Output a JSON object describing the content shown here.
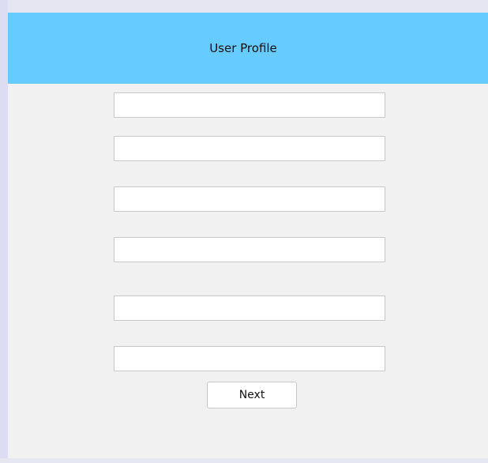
{
  "header": {
    "title": "User Profile",
    "background_color": "#66cbff"
  },
  "form": {
    "fields": [
      {
        "value": "",
        "placeholder": ""
      },
      {
        "value": "",
        "placeholder": ""
      },
      {
        "value": "",
        "placeholder": ""
      },
      {
        "value": "",
        "placeholder": ""
      },
      {
        "value": "",
        "placeholder": ""
      },
      {
        "value": "",
        "placeholder": ""
      }
    ],
    "next_label": "Next"
  },
  "colors": {
    "panel_background": "#f1f1f1",
    "field_border": "#c8c8c8"
  }
}
